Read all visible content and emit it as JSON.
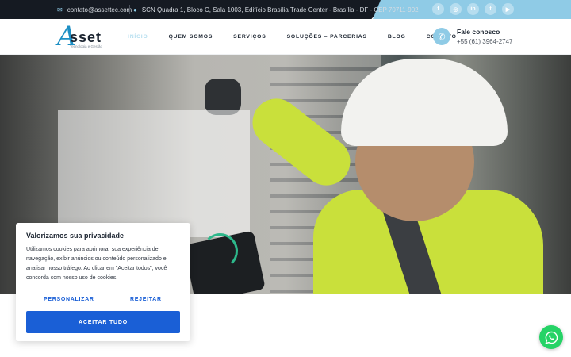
{
  "topbar": {
    "email": "contato@assettec.com",
    "address": "SCN Quadra 1, Bloco C, Sala 1003, Edifício Brasília Trade Center - Brasília - DF - CEP 70711-902",
    "socials": [
      {
        "name": "facebook-icon",
        "glyph": "f"
      },
      {
        "name": "instagram-icon",
        "glyph": "◎"
      },
      {
        "name": "linkedin-icon",
        "glyph": "in"
      },
      {
        "name": "twitter-icon",
        "glyph": "t"
      },
      {
        "name": "youtube-icon",
        "glyph": "▶"
      }
    ]
  },
  "header": {
    "logo_word": "sset",
    "logo_a": "A",
    "logo_sub": "Tecnologia e Gestão",
    "nav": [
      {
        "label": "INÍCIO",
        "active": true
      },
      {
        "label": "QUEM SOMOS",
        "active": false
      },
      {
        "label": "SERVIÇOS",
        "active": false
      },
      {
        "label": "SOLUÇÕES – PARCERIAS",
        "active": false
      },
      {
        "label": "BLOG",
        "active": false
      },
      {
        "label": "CONTATO",
        "active": false
      }
    ],
    "contact_title": "Fale conosco",
    "contact_phone": "+55 (61) 3964-2747"
  },
  "cookie": {
    "title": "Valorizamos sua privacidade",
    "text": "Utilizamos cookies para aprimorar sua experiência de navegação, exibir anúncios ou conteúdo personalizado e analisar nosso tráfego. Ao clicar em \"Aceitar todos\", você concorda com nosso uso de cookies.",
    "customize_label": "PERSONALIZAR",
    "reject_label": "REJEITAR",
    "accept_label": "ACEITAR TUDO"
  },
  "colors": {
    "accent": "#8fcbe6",
    "dark": "#151a22",
    "primary_button": "#1a5fd6",
    "whatsapp": "#25d366"
  }
}
